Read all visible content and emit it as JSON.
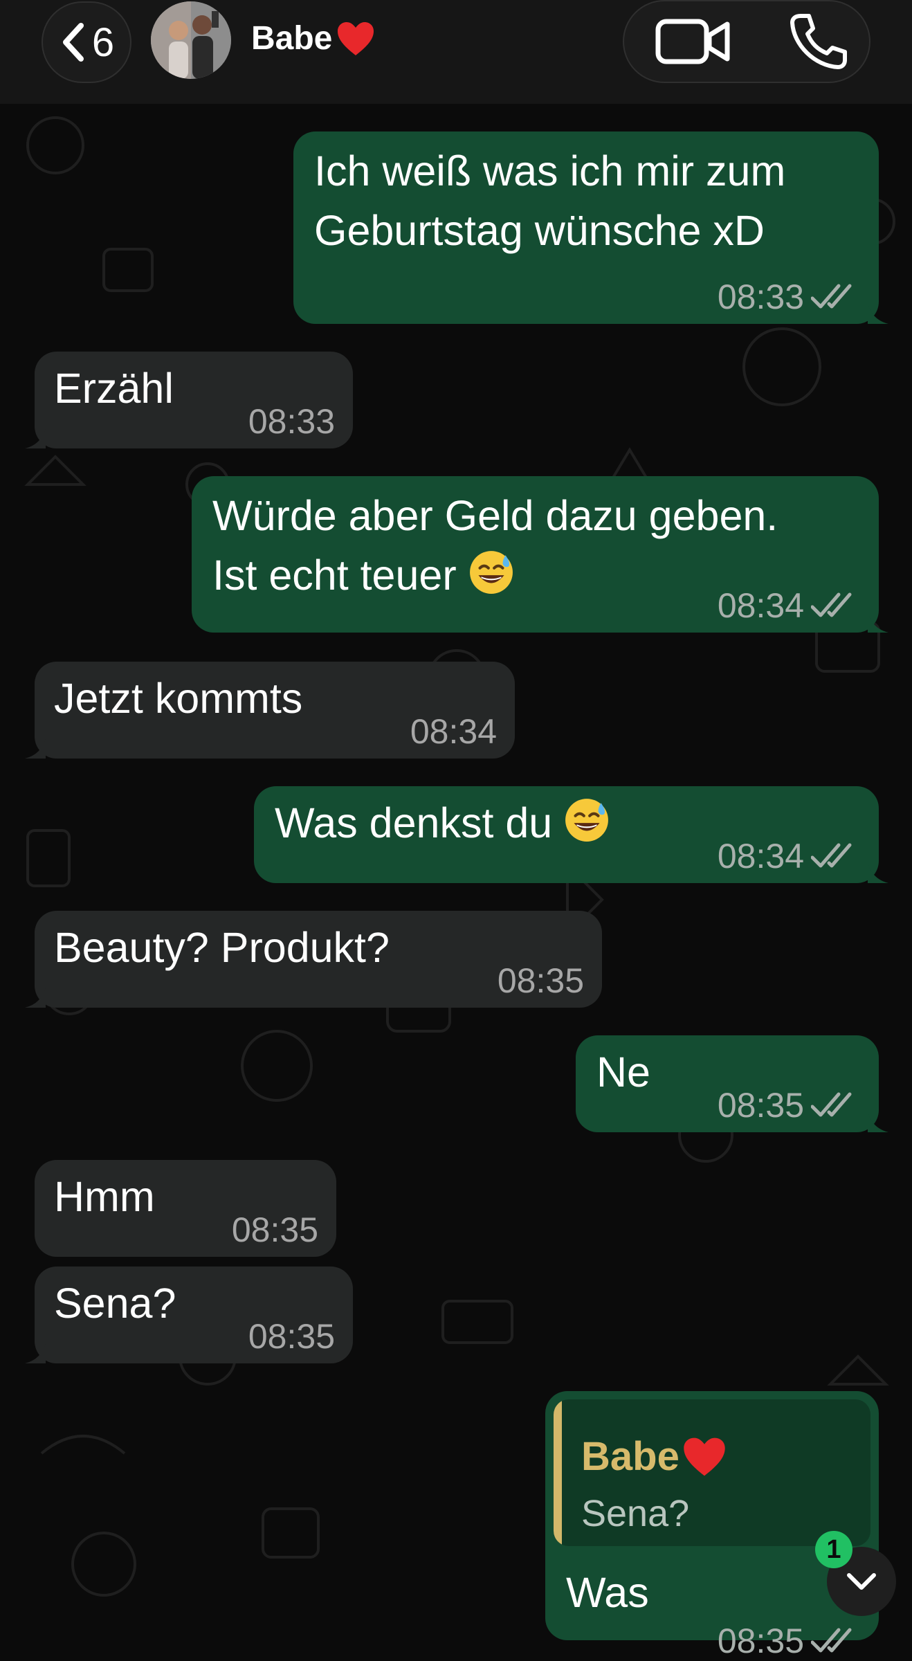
{
  "header": {
    "back_count": "6",
    "contact_name": "Babe",
    "contact_emoji": "red-heart"
  },
  "colors": {
    "incoming_bubble": "#252727",
    "outgoing_bubble": "#144d32",
    "read_ticks": "#a8b0ac",
    "reply_accent": "#d3b86a",
    "badge_green": "#21c063"
  },
  "messages": [
    {
      "direction": "out",
      "lines": [
        "Ich weiß was ich mir zum",
        "Geburtstag wünsche xD"
      ],
      "time": "08:33",
      "status": "read"
    },
    {
      "direction": "in",
      "lines": [
        "Erzähl"
      ],
      "time": "08:33"
    },
    {
      "direction": "out",
      "lines": [
        "Würde aber Geld dazu geben.",
        "Ist echt teuer"
      ],
      "emoji": "grinning-sweat",
      "time": "08:34",
      "status": "read"
    },
    {
      "direction": "in",
      "lines": [
        "Jetzt kommts"
      ],
      "time": "08:34"
    },
    {
      "direction": "out",
      "lines": [
        "Was denkst du"
      ],
      "emoji": "grinning-sweat",
      "time": "08:34",
      "status": "read"
    },
    {
      "direction": "in",
      "lines": [
        "Beauty? Produkt?"
      ],
      "time": "08:35"
    },
    {
      "direction": "out",
      "lines": [
        "Ne"
      ],
      "time": "08:35",
      "status": "read"
    },
    {
      "direction": "in",
      "lines": [
        "Hmm"
      ],
      "time": "08:35"
    },
    {
      "direction": "in",
      "lines": [
        "Sena?"
      ],
      "time": "08:35"
    },
    {
      "direction": "out",
      "reply_to": {
        "name": "Babe",
        "text": "Sena?"
      },
      "lines": [
        "Was"
      ],
      "time": "08:35",
      "status": "read"
    }
  ],
  "scroll_down": {
    "unread_count": "1"
  }
}
